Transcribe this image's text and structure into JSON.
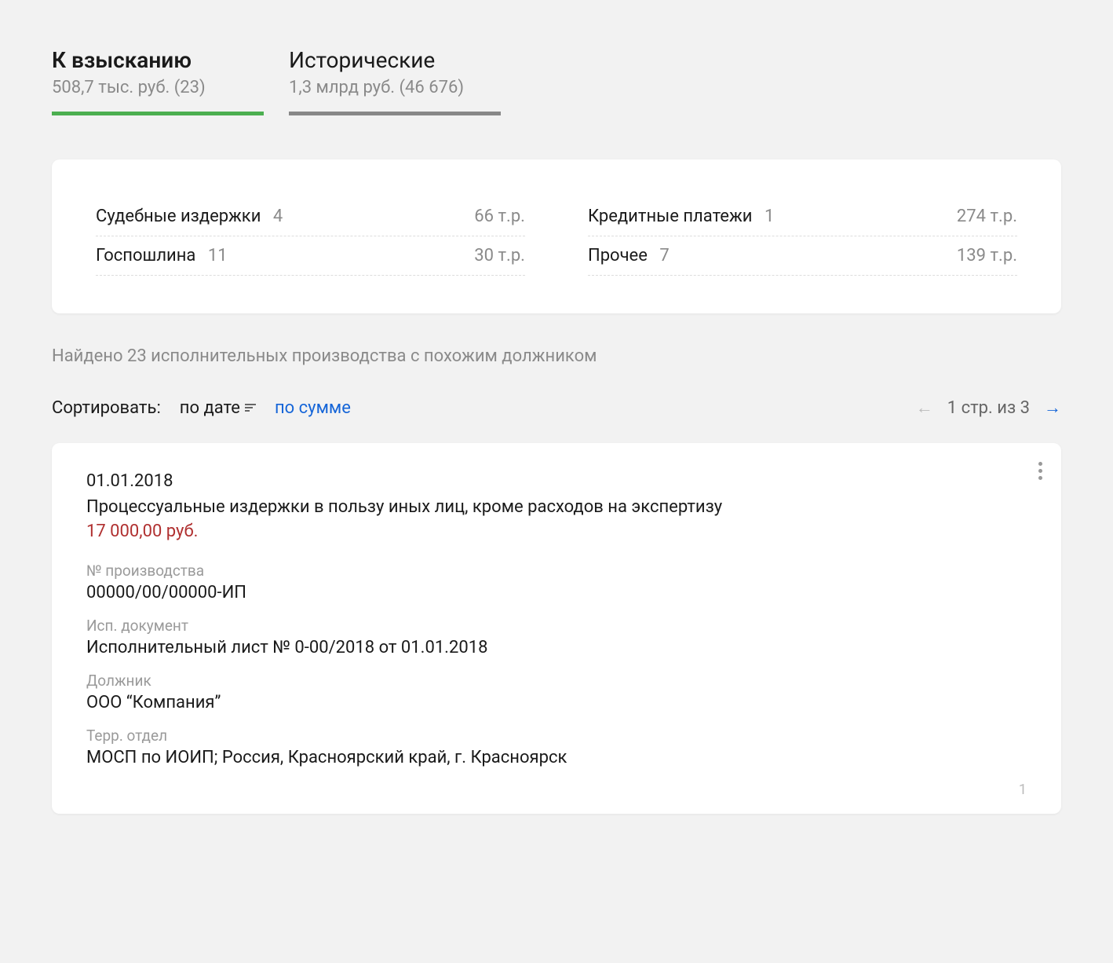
{
  "tabs": [
    {
      "title": "К взысканию",
      "subtitle": "508,7 тыс. руб. (23)",
      "active": true
    },
    {
      "title": "Исторические",
      "subtitle": "1,3 млрд руб. (46 676)",
      "active": false
    }
  ],
  "summary": {
    "left": [
      {
        "label": "Судебные издержки",
        "count": "4",
        "value": "66 т.р."
      },
      {
        "label": "Госпошлина",
        "count": "11",
        "value": "30 т.р."
      }
    ],
    "right": [
      {
        "label": "Кредитные платежи",
        "count": "1",
        "value": "274 т.р."
      },
      {
        "label": "Прочее",
        "count": "7",
        "value": "139 т.р."
      }
    ]
  },
  "found_text": "Найдено 23 исполнительных производства с похожим должником",
  "sort": {
    "label": "Сортировать:",
    "by_date": "по дате",
    "by_sum": "по сумме"
  },
  "pager": {
    "text": "1 стр. из 3"
  },
  "card": {
    "date": "01.01.2018",
    "title": "Процессуальные издержки в пользу иных лиц, кроме расходов на экспертизу",
    "amount": "17 000,00 руб.",
    "fields": {
      "case_no_label": "№ производства",
      "case_no_value": "00000/00/00000-ИП",
      "doc_label": "Исп. документ",
      "doc_value": "Исполнительный лист № 0-00/2018 от 01.01.2018",
      "debtor_label": "Должник",
      "debtor_value": "ООО “Компания”",
      "dept_label": "Терр. отдел",
      "dept_value": "МОСП по ИОИП; Россия, Красноярский край, г. Красноярск"
    },
    "index": "1"
  }
}
